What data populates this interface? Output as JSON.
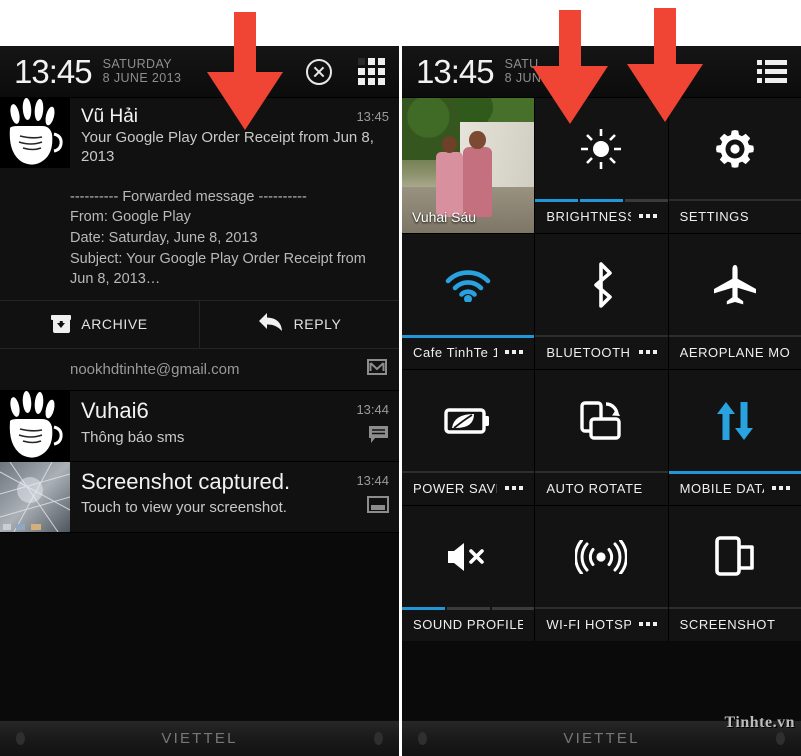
{
  "left_phone": {
    "statusbar": {
      "time": "13:45",
      "day": "SATURDAY",
      "date": "8 JUNE 2013",
      "close_icon": "close-circle-icon",
      "grid_icon": "app-grid-icon"
    },
    "notifications": [
      {
        "title": "Vũ Hải",
        "subtitle": "Your Google Play Order Receipt from Jun 8, 2013",
        "time": "13:45",
        "body": "---------- Forwarded message ----------\nFrom: Google Play\nDate: Saturday, June 8, 2013\nSubject: Your Google Play Order Receipt from Jun 8, 2013…",
        "actions": [
          {
            "label": "ARCHIVE",
            "icon": "archive-icon"
          },
          {
            "label": "REPLY",
            "icon": "reply-arrow-icon"
          }
        ],
        "account": "nookhdtinhte@gmail.com",
        "account_icon": "gmail-envelope-icon"
      },
      {
        "title": "Vuhai6",
        "subtitle": "Thông báo sms",
        "time": "13:44",
        "icon": "sms-bubble-icon"
      },
      {
        "title": "Screenshot captured.",
        "subtitle": "Touch to view your screenshot.",
        "time": "13:44",
        "icon": "screenshot-icon"
      }
    ],
    "navbar": {
      "carrier": "VIETTEL"
    }
  },
  "right_phone": {
    "statusbar": {
      "time": "13:45",
      "day": "SATU",
      "date": "8 JUN",
      "list_icon": "list-view-icon"
    },
    "tiles": [
      {
        "name": "contact-photo",
        "label": "Vuhai Sáu",
        "icon": "contact-photo",
        "active": false,
        "dots": false,
        "indicator": "none"
      },
      {
        "name": "brightness",
        "label": "BRIGHTNESS",
        "icon": "brightness-sun-icon",
        "active": false,
        "dots": true,
        "indicator": "segmented",
        "segments_on": 2,
        "segments_total": 3
      },
      {
        "name": "settings",
        "label": "SETTINGS",
        "icon": "settings-gear-icon",
        "active": false,
        "dots": false,
        "indicator": "none"
      },
      {
        "name": "wifi",
        "label": "Cafe TinhTe 1",
        "icon": "wifi-icon",
        "active": true,
        "dots": true,
        "indicator": "solid"
      },
      {
        "name": "bluetooth",
        "label": "BLUETOOTH",
        "icon": "bluetooth-icon",
        "active": false,
        "dots": true,
        "indicator": "divider"
      },
      {
        "name": "aeroplane-mode",
        "label": "AEROPLANE MODE",
        "icon": "aeroplane-icon",
        "active": false,
        "dots": false,
        "indicator": "divider"
      },
      {
        "name": "power-save",
        "label": "POWER SAVER",
        "icon": "battery-leaf-icon",
        "active": false,
        "dots": true,
        "indicator": "divider"
      },
      {
        "name": "auto-rotate",
        "label": "AUTO ROTATE",
        "icon": "auto-rotate-icon",
        "active": false,
        "dots": false,
        "indicator": "divider"
      },
      {
        "name": "mobile-data",
        "label": "MOBILE DATA",
        "icon": "mobile-data-arrows-icon",
        "active": true,
        "dots": true,
        "indicator": "solid"
      },
      {
        "name": "sound-profile",
        "label": "SOUND PROFILE",
        "icon": "speaker-mute-icon",
        "active": false,
        "dots": false,
        "indicator": "segmented",
        "segments_on": 1,
        "segments_total": 3
      },
      {
        "name": "wifi-hotspot",
        "label": "WI-FI HOTSPOT",
        "icon": "hotspot-icon",
        "active": false,
        "dots": true,
        "indicator": "divider"
      },
      {
        "name": "screenshot",
        "label": "SCREENSHOT",
        "icon": "screenshot-tile-icon",
        "active": false,
        "dots": false,
        "indicator": "divider"
      }
    ],
    "navbar": {
      "carrier": "VIETTEL"
    }
  },
  "watermark": "Tinhte.vn",
  "colors": {
    "accent_blue": "#29a3e0",
    "arrow_red": "#f04434",
    "tile_bg": "#131313",
    "panel_bg": "#0a0a0a"
  }
}
